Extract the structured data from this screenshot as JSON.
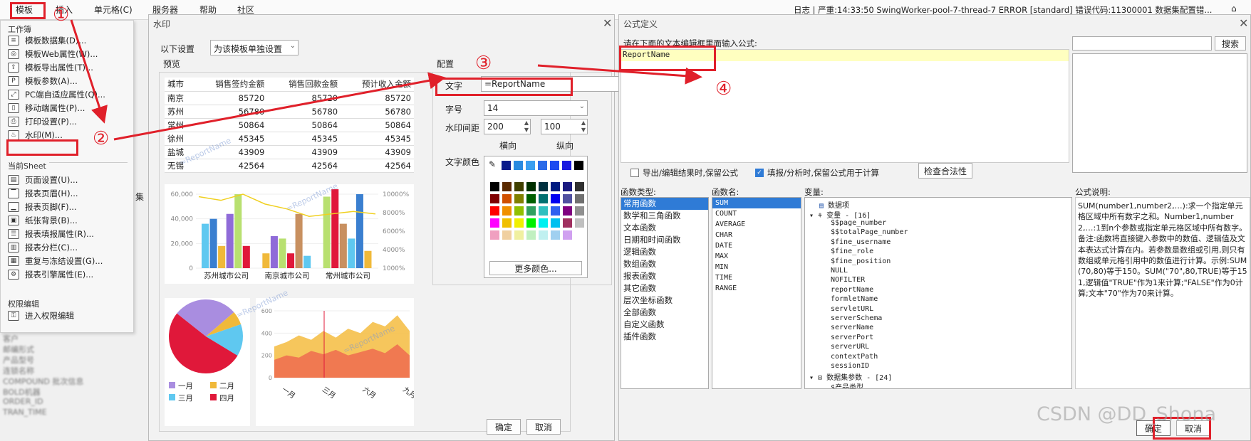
{
  "menubar": {
    "items": [
      "模板",
      "插入",
      "单元格(C)",
      "服务器",
      "帮助",
      "社区"
    ],
    "status": "日志 | 严重:14:33:50 SwingWorker-pool-7-thread-7 ERROR [standard] 错误代码:11300001 数据集配置错..."
  },
  "annotations": [
    "①",
    "②",
    "③",
    "④"
  ],
  "dropdown": {
    "section_workbook": "工作簿",
    "items_workbook": [
      {
        "label": "模板数据集(D)...",
        "icon": "database-icon"
      },
      {
        "label": "模板Web属性(W)...",
        "icon": "globe-icon"
      },
      {
        "label": "模板导出属性(T)...",
        "icon": "export-icon"
      },
      {
        "label": "模板参数(A)...",
        "icon": "param-icon"
      },
      {
        "label": "PC端自适应属性(Q)...",
        "icon": "resize-icon"
      },
      {
        "label": "移动端属性(P)...",
        "icon": "mobile-icon"
      },
      {
        "label": "打印设置(P)...",
        "icon": "printer-icon"
      },
      {
        "label": "水印(M)...",
        "icon": "watermark-icon"
      }
    ],
    "section_sheet": "当前Sheet",
    "items_sheet": [
      {
        "label": "页面设置(U)...",
        "icon": "page-setup-icon"
      },
      {
        "label": "报表页眉(H)...",
        "icon": "header-icon"
      },
      {
        "label": "报表页脚(F)...",
        "icon": "footer-icon"
      },
      {
        "label": "纸张背景(B)...",
        "icon": "image-icon"
      },
      {
        "label": "报表填报属性(R)...",
        "icon": "form-icon"
      },
      {
        "label": "报表分栏(C)...",
        "icon": "columns-icon"
      },
      {
        "label": "重复与冻结设置(G)...",
        "icon": "freeze-icon"
      },
      {
        "label": "报表引擎属性(E)...",
        "icon": "engine-icon"
      }
    ],
    "section_perm": "权限编辑",
    "items_perm": [
      {
        "label": "进入权限编辑",
        "icon": "permission-icon"
      }
    ]
  },
  "background_tree": [
    "客户",
    "邮编形式",
    "产品型号",
    "连锁名称",
    "COMPOUND 批次信息",
    "BOLD机器",
    "ORDER_ID",
    "TRAN_TIME"
  ],
  "bg_tab_label": "集",
  "watermark_dialog": {
    "title": "水印",
    "apply_label": "以下设置",
    "apply_value": "为该模板单独设置",
    "preview_label": "预览",
    "config_label": "配置",
    "text_label": "文字",
    "text_value": "=ReportName",
    "fontsize_label": "字号",
    "fontsize_value": "14",
    "spacing_label": "水印间距",
    "spacing_h": "200",
    "spacing_v": "100",
    "horizontal_label": "横向",
    "vertical_label": "纵向",
    "color_label": "文字颜色",
    "more_colors": "更多颜色...",
    "ok": "确定",
    "cancel": "取消",
    "watermark_text": "=ReportName",
    "table": {
      "headers": [
        "城市",
        "销售签约金额",
        "销售回款金额",
        "预计收入金额"
      ],
      "rows": [
        [
          "南京",
          "85720",
          "85720",
          "85720"
        ],
        [
          "苏州",
          "56780",
          "56780",
          "56780"
        ],
        [
          "常州",
          "50864",
          "50864",
          "50864"
        ],
        [
          "徐州",
          "45345",
          "45345",
          "45345"
        ],
        [
          "盐城",
          "43909",
          "43909",
          "43909"
        ],
        [
          "无锡",
          "42564",
          "42564",
          "42564"
        ]
      ]
    }
  },
  "chart_data": [
    {
      "type": "bar",
      "categories": [
        "苏州城市公司",
        "南京城市公司",
        "常州城市公司"
      ],
      "series": [
        {
          "values": [
            36000,
            40000,
            18000,
            44000,
            60000,
            18000
          ]
        },
        {
          "values": [
            12000,
            26000,
            24000,
            12000,
            44000,
            10000
          ]
        },
        {
          "values": [
            58000,
            64000,
            36000,
            24000,
            60000,
            14000
          ]
        }
      ],
      "ylim": [
        0,
        60000
      ],
      "yticks": [
        "0",
        "20,000",
        "40,000",
        "60,000"
      ],
      "y2ticks": [
        "1000%",
        "4000%",
        "6000%",
        "8000%",
        "10000%"
      ],
      "line_values": [
        58,
        55,
        60,
        52,
        48,
        42,
        44,
        46,
        44
      ]
    },
    {
      "type": "pie",
      "labels": [
        "一月",
        "二月",
        "三月",
        "四月"
      ],
      "values": [
        28,
        6,
        14,
        52
      ],
      "colors": [
        "#a98de0",
        "#f0b93a",
        "#5fc8f0",
        "#e0183a"
      ]
    },
    {
      "type": "area",
      "x": [
        "一月",
        "三月",
        "六月",
        "九月"
      ],
      "ylim": [
        0,
        600
      ],
      "yticks": [
        "0",
        "200",
        "400",
        "600"
      ],
      "series": [
        {
          "values": [
            280,
            320,
            380,
            340,
            420,
            360,
            440,
            400,
            500,
            460,
            560,
            420
          ]
        },
        {
          "values": [
            160,
            200,
            180,
            240,
            210,
            250,
            200,
            230,
            260,
            220,
            300,
            200
          ]
        }
      ]
    }
  ],
  "formula_dialog": {
    "title": "公式定义",
    "prompt": "请在下面的文本编辑框里面输入公式:",
    "formula": "ReportName",
    "search_button": "搜索",
    "opt_export": "导出/编辑结果时,保留公式",
    "opt_fill": "填报/分析时,保留公式用于计算",
    "check_button": "检查合法性",
    "func_type_label": "函数类型:",
    "func_name_label": "函数名:",
    "var_label": "变量:",
    "desc_label": "公式说明:",
    "func_types": [
      "常用函数",
      "数学和三角函数",
      "文本函数",
      "日期和时间函数",
      "逻辑函数",
      "数组函数",
      "报表函数",
      "其它函数",
      "层次坐标函数",
      "全部函数",
      "自定义函数",
      "插件函数"
    ],
    "func_names": [
      "SUM",
      "COUNT",
      "AVERAGE",
      "CHAR",
      "DATE",
      "MAX",
      "MIN",
      "TIME",
      "RANGE"
    ],
    "var_groups": [
      {
        "label": "数据项"
      },
      {
        "label": "变量 - [16]"
      }
    ],
    "variables": [
      "$$page_number",
      "$$totalPage_number",
      "$fine_username",
      "$fine_role",
      "$fine_position",
      "NULL",
      "NOFILTER",
      "reportName",
      "formletName",
      "servletURL",
      "serverSchema",
      "serverName",
      "serverPort",
      "serverURL",
      "contextPath",
      "sessionID"
    ],
    "dataset_group": "数据集参数 - [24]",
    "dataset_first": "$产品类型",
    "description": "SUM(number1,number2,…):求一个指定单元格区域中所有数字之和。Number1,number2,…:1到n个参数或指定单元格区域中所有数字。备注:函数将直接键入参数中的数值、逻辑值及文本表达式计算在内。若参数是数组或引用,则只有数组或单元格引用中的数值进行计算。示例:SUM(70,80)等于150。SUM(\"70\",80,TRUE)等于151,逻辑值\"TRUE\"作为1来计算;\"FALSE\"作为0计算;文本\"70\"作为70来计算。",
    "ok": "确定",
    "cancel": "取消"
  },
  "page_watermark": "CSDN @DD_Shona"
}
